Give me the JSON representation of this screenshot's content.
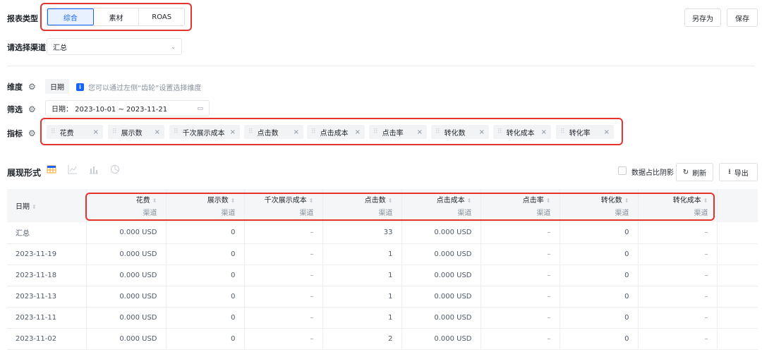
{
  "report_type": {
    "label": "报表类型",
    "tabs": [
      "综合",
      "素材",
      "ROAS"
    ],
    "active": 0
  },
  "actions": {
    "save_as": "另存为",
    "save": "保存"
  },
  "channel": {
    "label": "请选择渠道",
    "value": "汇总"
  },
  "dimension": {
    "label": "维度",
    "chip": "日期",
    "hint": "您可以通过左侧“齿轮”设置选择维度"
  },
  "filter": {
    "label": "筛选",
    "value": "日期：  2023-10-01 ~ 2023-11-21"
  },
  "metrics": {
    "label": "指标",
    "tags": [
      "花费",
      "展示数",
      "千次展示成本",
      "点击数",
      "点击成本",
      "点击率",
      "转化数",
      "转化成本",
      "转化率"
    ]
  },
  "display": {
    "label": "展现形式",
    "shadow_label": "数据占比阴影",
    "refresh": "刷新",
    "export": "导出"
  },
  "table": {
    "columns": [
      {
        "title": "日期",
        "sub": ""
      },
      {
        "title": "花费",
        "sub": "渠道"
      },
      {
        "title": "展示数",
        "sub": "渠道"
      },
      {
        "title": "千次展示成本",
        "sub": "渠道"
      },
      {
        "title": "点击数",
        "sub": "渠道"
      },
      {
        "title": "点击成本",
        "sub": "渠道"
      },
      {
        "title": "点击率",
        "sub": "渠道"
      },
      {
        "title": "转化数",
        "sub": "渠道"
      },
      {
        "title": "转化成本",
        "sub": "渠道"
      }
    ],
    "rows": [
      [
        "汇总",
        "0.000 USD",
        "0",
        "–",
        "33",
        "0.000 USD",
        "–",
        "0",
        "–"
      ],
      [
        "2023-11-19",
        "0.000 USD",
        "0",
        "–",
        "1",
        "0.000 USD",
        "–",
        "0",
        "–"
      ],
      [
        "2023-11-18",
        "0.000 USD",
        "0",
        "–",
        "1",
        "0.000 USD",
        "–",
        "0",
        "–"
      ],
      [
        "2023-11-13",
        "0.000 USD",
        "0",
        "–",
        "1",
        "0.000 USD",
        "–",
        "0",
        "–"
      ],
      [
        "2023-11-11",
        "0.000 USD",
        "0",
        "–",
        "1",
        "0.000 USD",
        "–",
        "0",
        "–"
      ],
      [
        "2023-11-02",
        "0.000 USD",
        "0",
        "–",
        "2",
        "0.000 USD",
        "–",
        "0",
        "–"
      ]
    ]
  },
  "colors": {
    "accent": "#1664ff",
    "highlight": "#e5332e"
  }
}
